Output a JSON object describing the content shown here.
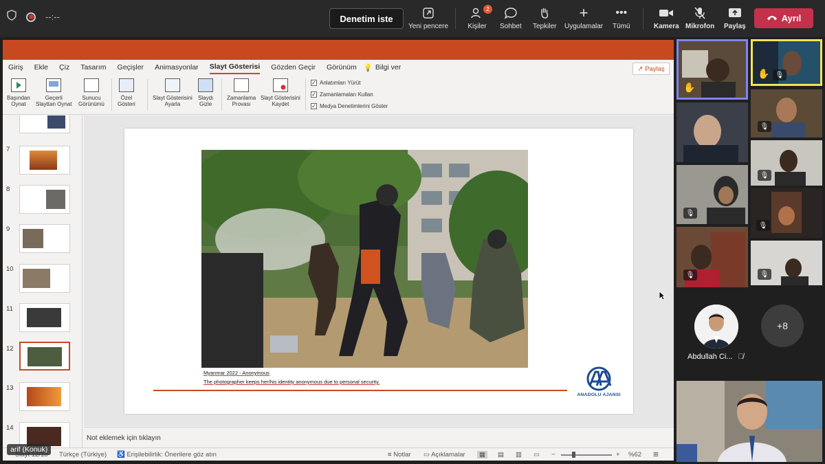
{
  "topbar": {
    "timer": "--:--",
    "control_request": "Denetim iste",
    "new_window": "Yeni pencere",
    "people": "Kişiler",
    "people_count": "2",
    "chat": "Sohbet",
    "reactions": "Tepkiler",
    "apps": "Uygulamalar",
    "more": "Tümü",
    "camera": "Kamera",
    "mic": "Mikrofon",
    "share": "Paylaş",
    "leave": "Ayrıl"
  },
  "ppt": {
    "tabs": [
      "Giriş",
      "Ekle",
      "Çiz",
      "Tasarım",
      "Geçişler",
      "Animasyonlar",
      "Slayt Gösterisi",
      "Gözden Geçir",
      "Görünüm"
    ],
    "active_tab": "Slayt Gösterisi",
    "tell_me": "Bilgi ver",
    "share": "Paylaş",
    "ribbon": {
      "from_beginning": [
        "Başından",
        "Oynat"
      ],
      "from_current": [
        "Geçerli",
        "Slayttan Oynat"
      ],
      "presenter_view": [
        "Sunucu",
        "Görünümü"
      ],
      "custom_show": [
        "Özel",
        "Gösteri"
      ],
      "setup_show": [
        "Slayt Gösterisini",
        "Ayarla"
      ],
      "hide_slide": [
        "Slaydı",
        "Gizle"
      ],
      "rehearse": [
        "Zamanlama",
        "Provası"
      ],
      "record": [
        "Slayt Gösterisini",
        "Kaydet"
      ],
      "checks": [
        "Anlatımları Yürüt",
        "Zamanlamaları Kullan",
        "Medya Denetimlerini Göster"
      ]
    },
    "thumbnails": [
      "7",
      "8",
      "9",
      "10",
      "11",
      "12",
      "13",
      "14"
    ],
    "selected_slide": "12",
    "slide": {
      "caption_title": "Myanmar 2022 - Anonymous",
      "caption_text": "The photographer keeps her/his identity anonymous due to personal security.",
      "logo_text": "ANADOLU AJANSI",
      "logo_mark": "AA"
    },
    "notes_placeholder": "Not eklemek için tıklayın",
    "status": {
      "slide_counter": "Slayt 12/18",
      "language": "Türkçe (Türkiye)",
      "accessibility": "Erişilebilirlik: Önerilere göz atın",
      "notes": "Notlar",
      "comments": "Açıklamalar",
      "zoom": "%62"
    }
  },
  "presenter_label": "arif (Konuk)",
  "participants": {
    "named": "Abdullah Ci...",
    "overflow": "+8"
  },
  "colors": {
    "ppt_accent": "#c8491f",
    "leave": "#c4314b",
    "raise_hand": "#f2c94c"
  }
}
